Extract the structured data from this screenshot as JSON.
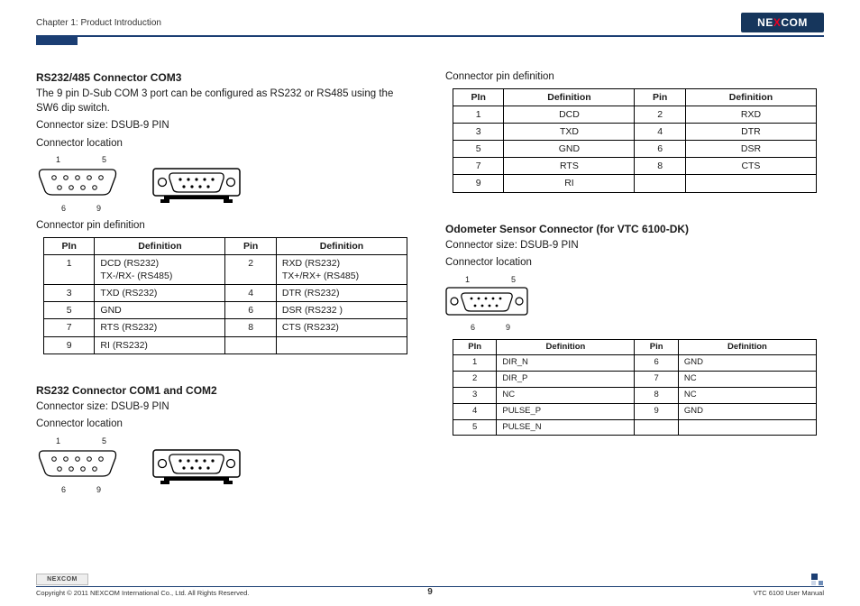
{
  "header": {
    "chapter": "Chapter 1: Product Introduction",
    "brand": "NEXCOM"
  },
  "left": {
    "sec1": {
      "title": "RS232/485 Connector COM3",
      "desc": "The 9 pin D-Sub COM 3 port can be configured as RS232 or RS485 using the SW6 dip switch.",
      "size": "Connector size: DSUB-9 PIN",
      "loc": "Connector location",
      "pindef_label": "Connector pin definition",
      "headers": {
        "p1": "PIn",
        "d1": "Definition",
        "p2": "Pin",
        "d2": "Definition"
      },
      "rows": [
        {
          "p1": "1",
          "d1": "DCD (RS232)\nTX-/RX- (RS485)",
          "p2": "2",
          "d2": "RXD (RS232)\nTX+/RX+ (RS485)"
        },
        {
          "p1": "3",
          "d1": "TXD (RS232)",
          "p2": "4",
          "d2": "DTR (RS232)"
        },
        {
          "p1": "5",
          "d1": "GND",
          "p2": "6",
          "d2": "DSR (RS232 )"
        },
        {
          "p1": "7",
          "d1": "RTS (RS232)",
          "p2": "8",
          "d2": "CTS (RS232)"
        },
        {
          "p1": "9",
          "d1": "RI (RS232)",
          "p2": "",
          "d2": ""
        }
      ]
    },
    "sec2": {
      "title": "RS232 Connector COM1 and COM2",
      "size": "Connector size: DSUB-9 PIN",
      "loc": "Connector location"
    }
  },
  "right": {
    "sec1": {
      "pindef_label": "Connector pin definition",
      "headers": {
        "p1": "PIn",
        "d1": "Definition",
        "p2": "Pin",
        "d2": "Definition"
      },
      "rows": [
        {
          "p1": "1",
          "d1": "DCD",
          "p2": "2",
          "d2": "RXD"
        },
        {
          "p1": "3",
          "d1": "TXD",
          "p2": "4",
          "d2": "DTR"
        },
        {
          "p1": "5",
          "d1": "GND",
          "p2": "6",
          "d2": "DSR"
        },
        {
          "p1": "7",
          "d1": "RTS",
          "p2": "8",
          "d2": "CTS"
        },
        {
          "p1": "9",
          "d1": "RI",
          "p2": "",
          "d2": ""
        }
      ]
    },
    "sec2": {
      "title": "Odometer Sensor Connector (for VTC 6100-DK)",
      "size": "Connector size: DSUB-9 PIN",
      "loc": "Connector location",
      "headers": {
        "p1": "PIn",
        "d1": "Definition",
        "p2": "Pin",
        "d2": "Definition"
      },
      "rows": [
        {
          "p1": "1",
          "d1": "DIR_N",
          "p2": "6",
          "d2": "GND"
        },
        {
          "p1": "2",
          "d1": "DIR_P",
          "p2": "7",
          "d2": "NC"
        },
        {
          "p1": "3",
          "d1": "NC",
          "p2": "8",
          "d2": "NC"
        },
        {
          "p1": "4",
          "d1": "PULSE_P",
          "p2": "9",
          "d2": "GND"
        },
        {
          "p1": "5",
          "d1": "PULSE_N",
          "p2": "",
          "d2": ""
        }
      ]
    }
  },
  "db9": {
    "t1": "1",
    "t5": "5",
    "b6": "6",
    "b9": "9"
  },
  "footer": {
    "copyright": "Copyright © 2011 NEXCOM International Co., Ltd. All Rights Reserved.",
    "page": "9",
    "doc": "VTC 6100 User Manual",
    "brand": "NEXCOM"
  }
}
